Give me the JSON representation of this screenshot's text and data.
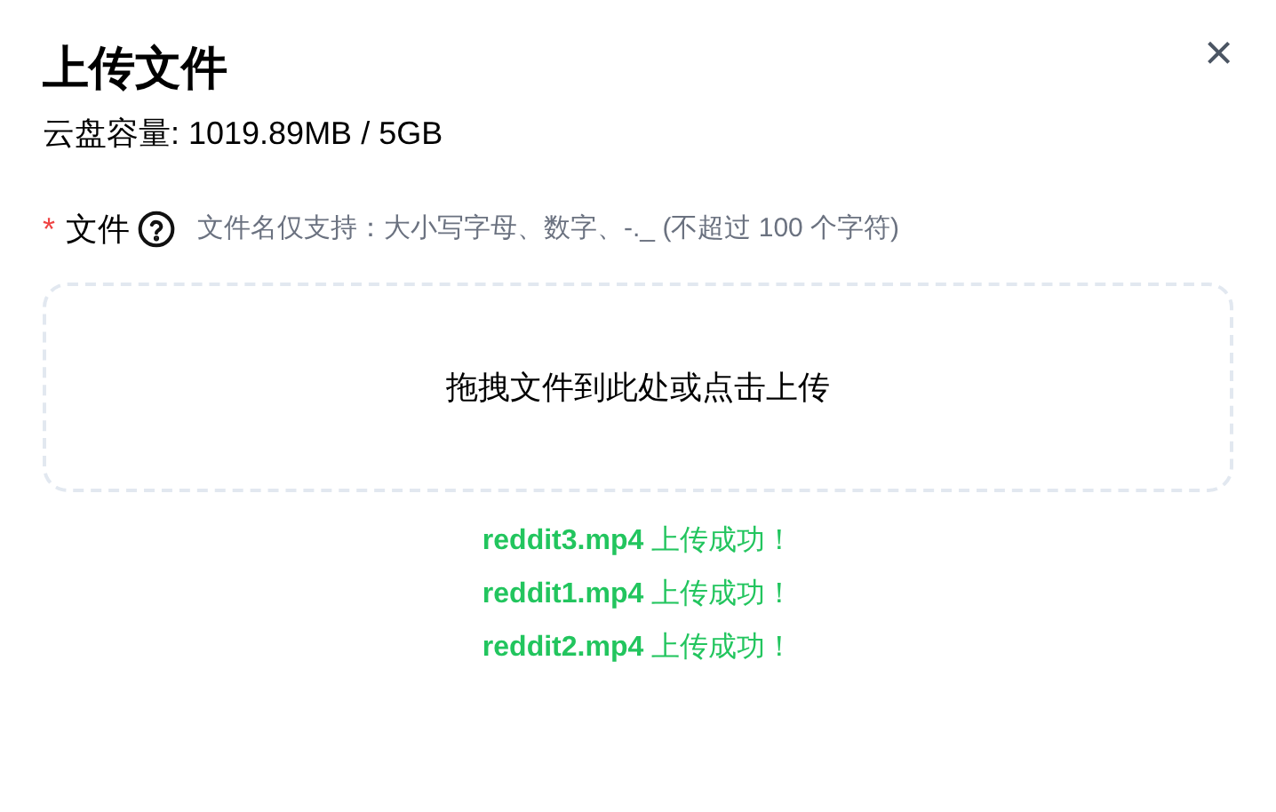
{
  "dialog": {
    "title": "上传文件",
    "close": "×",
    "capacity": "云盘容量: 1019.89MB / 5GB"
  },
  "field": {
    "required_mark": "*",
    "label": "文件",
    "hint": "文件名仅支持：大小写字母、数字、-._ (不超过 100 个字符)"
  },
  "dropzone": {
    "text": "拖拽文件到此处或点击上传"
  },
  "results": [
    {
      "text": "**reddit3.mp4** 上传成功！",
      "color": "#22c55e"
    },
    {
      "text": "**reddit1.mp4** 上传成功！",
      "color": "#22c55e"
    },
    {
      "text": "**reddit2.mp4** 上传成功！",
      "color": "#22c55e"
    }
  ]
}
